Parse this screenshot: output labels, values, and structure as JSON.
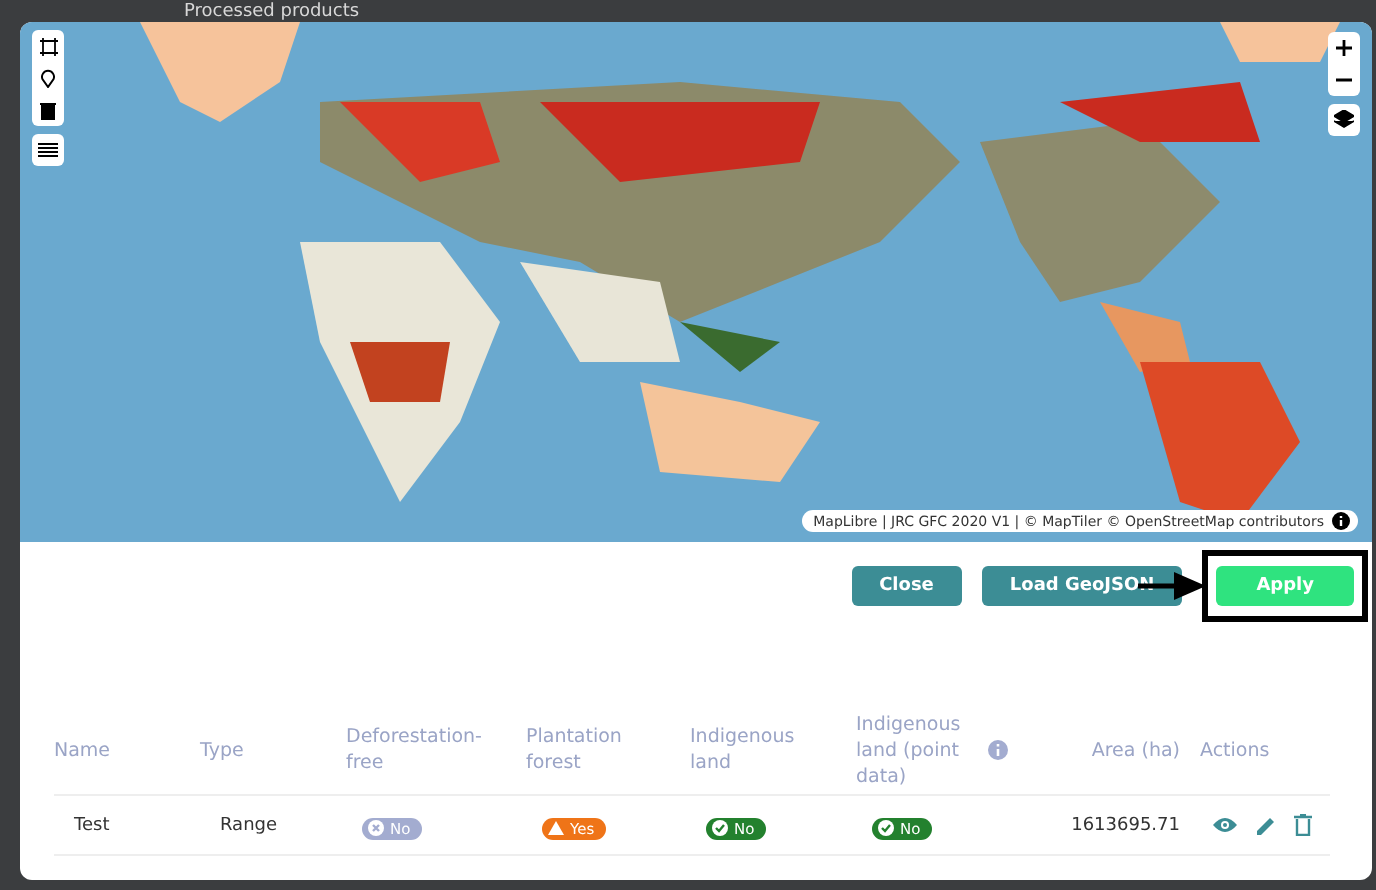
{
  "background": {
    "title": "Processed products"
  },
  "map": {
    "kind": "picture",
    "attribution": "MapLibre | JRC GFC 2020 V1 | © MapTiler © OpenStreetMap contributors"
  },
  "buttons": [
    {
      "label": "Close",
      "kind": "secondary",
      "highlighted": false
    },
    {
      "label": "Load GeoJSON",
      "kind": "secondary",
      "highlighted": false
    },
    {
      "label": "Apply",
      "kind": "primary",
      "highlighted": true
    }
  ],
  "table": {
    "columns": [
      {
        "label": "Name",
        "info": false
      },
      {
        "label": "Type",
        "info": false
      },
      {
        "label": "Deforestation-free",
        "info": false
      },
      {
        "label": "Plantation forest",
        "info": false
      },
      {
        "label": "Indigenous land",
        "info": false
      },
      {
        "label": "Indigenous land (point data)",
        "info": true
      },
      {
        "label": "Area (ha)",
        "info": false
      },
      {
        "label": "Actions",
        "info": false
      }
    ],
    "rows": [
      {
        "cells": [
          {
            "kind": "text",
            "text": "Test"
          },
          {
            "kind": "text",
            "text": "Range"
          },
          {
            "kind": "cross",
            "text": "No"
          },
          {
            "kind": "warning",
            "text": "Yes"
          },
          {
            "kind": "check",
            "text": "No"
          },
          {
            "kind": "check",
            "text": "No"
          },
          {
            "kind": "number",
            "text": "1613695.71"
          },
          {
            "kind": "actions"
          }
        ]
      }
    ]
  }
}
